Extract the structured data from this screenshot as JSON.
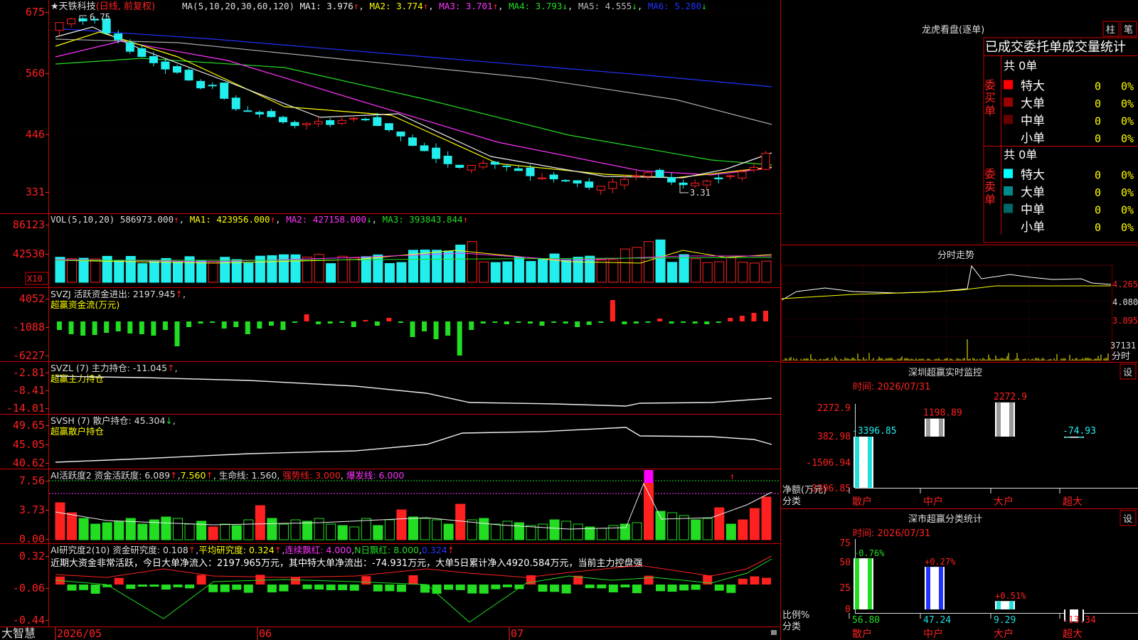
{
  "colors": {
    "up": "#ff2020",
    "down": "#22eeee",
    "frame": "#cc0000",
    "text": "#dddddd",
    "yellow": "#ffff00",
    "magenta": "#ff33ff",
    "green": "#22dd22",
    "white": "#eeeeee",
    "blue": "#2233ff",
    "gray": "#aaaaaa",
    "ma5color": "#bbbbbb"
  },
  "brand": "大智慧",
  "date_axis": [
    "2026/05",
    "06",
    "07"
  ],
  "price_panel": {
    "title_star": "★",
    "stock": "天铁科技",
    "mode": "(日线, 前复权)",
    "ma_label": "MA(5,10,20,30,60,120)",
    "ma_values": [
      {
        "label": "MA1:",
        "value": "3.976",
        "arrow": "↑"
      },
      {
        "label": "MA2:",
        "value": "3.774",
        "arrow": "↑"
      },
      {
        "label": "MA3:",
        "value": "3.701",
        "arrow": "↑"
      },
      {
        "label": "MA4:",
        "value": "3.793",
        "arrow": "↓"
      },
      {
        "label": "MA5:",
        "value": "4.555",
        "arrow": "↓"
      },
      {
        "label": "MA6:",
        "value": "5.280",
        "arrow": "↓"
      }
    ],
    "y_ticks": [
      "675",
      "560",
      "446",
      "331"
    ],
    "high_mark": "6.75",
    "low_mark": "3.31"
  },
  "vol_panel": {
    "title": "VOL(5,10,20)",
    "values": [
      {
        "label": "",
        "value": "586973.000",
        "arrow": "↑"
      },
      {
        "label": "MA1:",
        "value": "423956.000",
        "arrow": "↑"
      },
      {
        "label": "MA2:",
        "value": "427158.000",
        "arrow": "↓"
      },
      {
        "label": "MA3:",
        "value": "393843.844",
        "arrow": "↑"
      }
    ],
    "y_ticks": [
      "86123",
      "42530"
    ],
    "unit": "X10"
  },
  "svzj_panel": {
    "title": "SVZJ  活跃资金进出: 2197.945",
    "arrow": "↑",
    "sub": "超赢资金流(万元)",
    "y_ticks": [
      "4052",
      "-1088",
      "-6227"
    ]
  },
  "svzl_panel": {
    "title": "SVZL (7) 主力持仓: -11.045",
    "arrow": "↑",
    "sub": "超赢主力持仓",
    "y_ticks": [
      "-2.81",
      "-8.41",
      "-14.01"
    ]
  },
  "svsh_panel": {
    "title": "SVSH (7) 散户持仓: 45.304",
    "arrow": "↓",
    "sub": "超赢散户持仓",
    "y_ticks": [
      "49.65",
      "45.05",
      "40.62"
    ]
  },
  "ai1_panel": {
    "title": "AI活跃度2 资金活跃度: 6.089",
    "v2": "7.560",
    "v3": "生命线: 1.560",
    "v4": "强势线: 3.000",
    "v5": "爆发线: 6.000",
    "y_ticks": [
      "7.56",
      "3.73",
      "0.00"
    ]
  },
  "ai2_panel": {
    "title": "AI研究度2(10) 资金研究度: 0.108",
    "v2": "平均研究度: 0.324",
    "v3": "连续飘红: 4.000",
    "v4": "N日飘红: 8.000",
    "v5": "0.324",
    "comment": "近期大资金非常活跃，今日大单净流入：2197.965万元，其中特大单净流出：-74.931万元，大单5日累计净入4920.584万元，当前主力控盘强",
    "y_ticks": [
      "0.32",
      "-0.06",
      "-0.44"
    ]
  },
  "right_panel": {
    "dragon_title": "龙虎看盘(逐单)",
    "btn_zhu": "柱",
    "btn_bi": "笔",
    "stat_title": "已成交委托单成交量统计",
    "buy_side": "委买单",
    "sell_side": "委卖单",
    "buy_total": "共 0单",
    "sell_total": "共 0单",
    "rows": [
      {
        "label": "特大",
        "count": "0",
        "pct": "0%"
      },
      {
        "label": "大单",
        "count": "0",
        "pct": "0%"
      },
      {
        "label": "中单",
        "count": "0",
        "pct": "0%"
      },
      {
        "label": "小单",
        "count": "0",
        "pct": "0%"
      }
    ],
    "buy_colors": [
      "#ff0000",
      "#990000",
      "#660000",
      "#000000"
    ],
    "sell_colors": [
      "#00ffff",
      "#008a8a",
      "#006666",
      "#000000"
    ],
    "intraday_title": "分时走势",
    "intraday_ticks": [
      "4.265",
      "4.080",
      "3.895"
    ],
    "intraday_vol": "37131",
    "intraday_vol_label": "分时",
    "sz_title": "深圳超赢实时监控",
    "sz_time": "时间: 2026/07/31",
    "sz_y_ticks": [
      "2272.9",
      "382.98",
      "-1506.94",
      "-3396.85"
    ],
    "sz_ylabel1": "净额(万元)",
    "sz_ylabel2": "分类",
    "sz_btn": "设",
    "dist_title": "深市超赢分类统计",
    "dist_time": "时间: 2026/07/31",
    "dist_y_ticks": [
      "75",
      "50",
      "25",
      "0"
    ],
    "dist_ylabel1": "比例%",
    "dist_ylabel2": "分类",
    "dist_btn": "设"
  },
  "chart_data": [
    {
      "type": "bar",
      "title": "深圳超赢实时监控",
      "ylabel": "净额(万元)",
      "categories": [
        "散户",
        "中户",
        "大户",
        "超大"
      ],
      "values": [
        -3396.85,
        1198.89,
        2272.9,
        -74.93
      ],
      "labels": [
        "-3396.85",
        "1198.89",
        "2272.9",
        "-74.93"
      ],
      "ylim": [
        -3396.85,
        2272.9
      ]
    },
    {
      "type": "bar",
      "title": "深市超赢分类统计",
      "ylabel": "比例%",
      "categories": [
        "散户",
        "中户",
        "大户",
        "超大"
      ],
      "values": [
        56.8,
        47.24,
        9.29,
        -13.34
      ],
      "change_labels": [
        "-0.76%",
        "+0.27%",
        "+0.51%",
        ""
      ],
      "labels": [
        "56.80",
        "47.24",
        "9.29",
        "-13.34"
      ],
      "ylim": [
        0,
        75
      ]
    }
  ]
}
